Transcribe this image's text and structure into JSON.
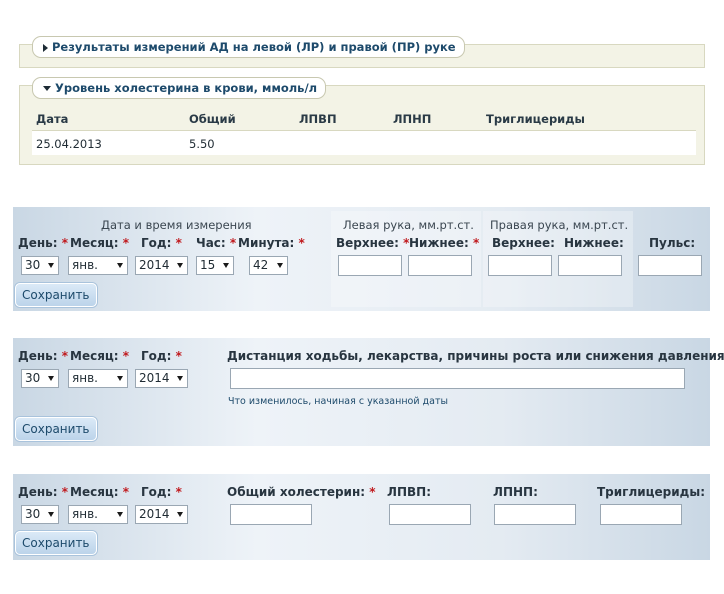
{
  "bp_results_legend": "Результаты измерений АД на левой (ЛР) и правой (ПР) руке",
  "chol_legend": "Уровень холестерина в крови, ммоль/л",
  "chol_table": {
    "headers": [
      "Дата",
      "Общий",
      "ЛПВП",
      "ЛПНП",
      "Триглицериды"
    ],
    "rows": [
      [
        "25.04.2013",
        "5.50",
        "",
        "",
        ""
      ]
    ]
  },
  "form_bp": {
    "datetime_caption": "Дата и время измерения",
    "left_caption": "Левая рука, мм.рт.ст.",
    "right_caption": "Правая рука, мм.рт.ст.",
    "day_label": "День:",
    "month_label": "Месяц:",
    "year_label": "Год:",
    "hour_label": "Час:",
    "minute_label": "Минута:",
    "upper_label": "Верхнее:",
    "lower_label": "Нижнее:",
    "pulse_label": "Пульс:",
    "day_value": "30",
    "month_value": "янв.",
    "year_value": "2014",
    "hour_value": "15",
    "minute_value": "42",
    "save": "Сохранить"
  },
  "form_notes": {
    "day_label": "День:",
    "month_label": "Месяц:",
    "year_label": "Год:",
    "day_value": "30",
    "month_value": "янв.",
    "year_value": "2014",
    "distance_label": "Дистанция ходьбы, лекарства, причины роста или снижения давления:",
    "hint": "Что изменилось, начиная с указанной даты",
    "save": "Сохранить"
  },
  "form_chol": {
    "day_label": "День:",
    "month_label": "Месяц:",
    "year_label": "Год:",
    "day_value": "30",
    "month_value": "янв.",
    "year_value": "2014",
    "total_label": "Общий холестерин:",
    "hdl_label": "ЛПВП:",
    "ldl_label": "ЛПНП:",
    "trig_label": "Триглицериды:",
    "save": "Сохранить"
  },
  "required_mark": "*"
}
